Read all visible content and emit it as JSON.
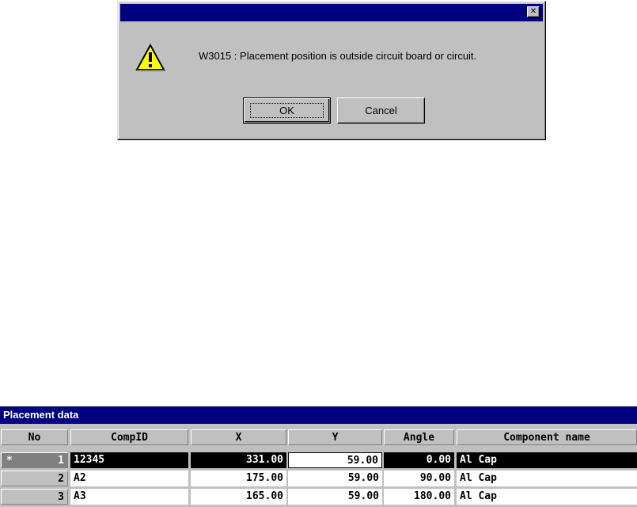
{
  "dialog": {
    "message": "W3015 : Placement position is outside circuit board or circuit.",
    "ok_label": "OK",
    "cancel_label": "Cancel",
    "close_glyph": "✕",
    "icon": "warning-icon"
  },
  "grid": {
    "title": "Placement data",
    "columns": [
      "No",
      "CompID",
      "X",
      "Y",
      "Angle",
      "Component name"
    ],
    "current_marker": "*",
    "rows": [
      {
        "no": "1",
        "compid": "12345",
        "x": "331.00",
        "y": "59.00",
        "angle": "0.00",
        "name": "Al Cap"
      },
      {
        "no": "2",
        "compid": "A2",
        "x": "175.00",
        "y": "59.00",
        "angle": "90.00",
        "name": "Al Cap"
      },
      {
        "no": "3",
        "compid": "A3",
        "x": "165.00",
        "y": "59.00",
        "angle": "180.00",
        "name": "Al Cap"
      }
    ]
  },
  "colors": {
    "titlebar": "#000080",
    "face": "#c0c0c0",
    "selection": "#000000"
  }
}
